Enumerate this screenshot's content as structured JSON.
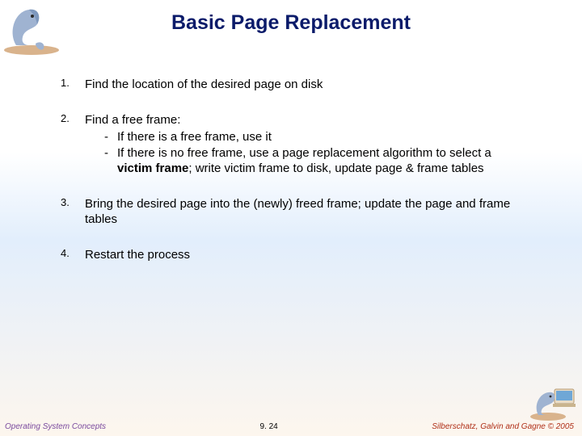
{
  "title": "Basic Page Replacement",
  "items": {
    "n1": "1.",
    "t1": "Find the location of the desired page on disk",
    "n2": "2.",
    "t2": "Find a free frame:",
    "t2a_pre": "If there is a free frame, use it",
    "t2b_pre": "If there is no free frame, use a page replacement algorithm to select a ",
    "t2b_bold": "victim frame",
    "t2b_post": "; write victim frame to disk, update page & frame tables",
    "n3": "3.",
    "t3": "Bring  the desired page into the (newly) freed frame; update the page and frame tables",
    "n4": "4.",
    "t4": "Restart the process"
  },
  "dash": "-",
  "footer": {
    "left": "Operating System Concepts",
    "center": "9. 24",
    "right": "Silberschatz, Galvin and Gagne © 2005"
  }
}
